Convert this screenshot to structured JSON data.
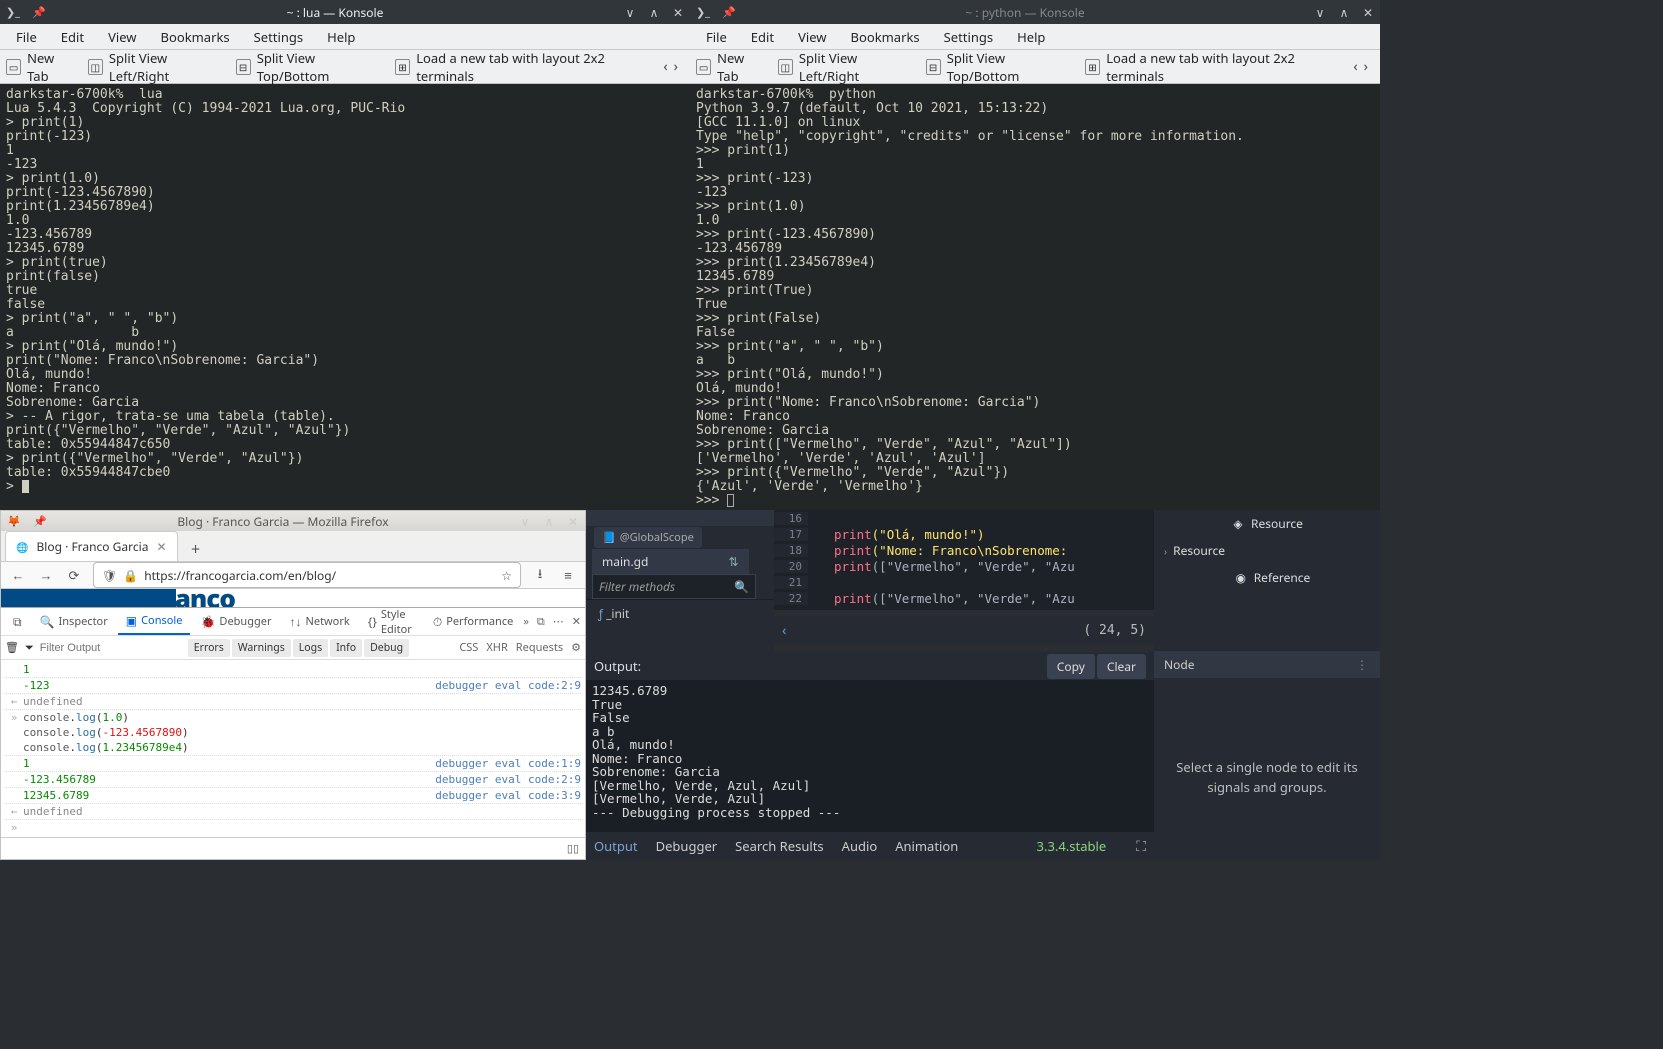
{
  "konsole_left": {
    "title": "~ : lua — Konsole",
    "menu": [
      "File",
      "Edit",
      "View",
      "Bookmarks",
      "Settings",
      "Help"
    ],
    "toolbar": {
      "new_tab": "New Tab",
      "split_lr": "Split View Left/Right",
      "split_tb": "Split View Top/Bottom",
      "load_layout": "Load a new tab with layout 2x2 terminals"
    },
    "term": "darkstar-6700k%  lua\nLua 5.4.3  Copyright (C) 1994-2021 Lua.org, PUC-Rio\n> print(1)\nprint(-123)\n1\n-123\n> print(1.0)\nprint(-123.4567890)\nprint(1.23456789e4)\n1.0\n-123.456789\n12345.6789\n> print(true)\nprint(false)\ntrue\nfalse\n> print(\"a\", \" \", \"b\")\na               b\n> print(\"Olá, mundo!\")\nprint(\"Nome: Franco\\nSobrenome: Garcia\")\nOlá, mundo!\nNome: Franco\nSobrenome: Garcia\n> -- A rigor, trata-se uma tabela (table).\nprint({\"Vermelho\", \"Verde\", \"Azul\", \"Azul\"})\ntable: 0x55944847c650\n> print({\"Vermelho\", \"Verde\", \"Azul\"})\ntable: 0x55944847cbe0\n> "
  },
  "konsole_right": {
    "title": "~ : python — Konsole",
    "menu": [
      "File",
      "Edit",
      "View",
      "Bookmarks",
      "Settings",
      "Help"
    ],
    "toolbar": {
      "new_tab": "New Tab",
      "split_lr": "Split View Left/Right",
      "split_tb": "Split View Top/Bottom",
      "load_layout": "Load a new tab with layout 2x2 terminals"
    },
    "term": "darkstar-6700k%  python\nPython 3.9.7 (default, Oct 10 2021, 15:13:22)\n[GCC 11.1.0] on linux\nType \"help\", \"copyright\", \"credits\" or \"license\" for more information.\n>>> print(1)\n1\n>>> print(-123)\n-123\n>>> print(1.0)\n1.0\n>>> print(-123.4567890)\n-123.456789\n>>> print(1.23456789e4)\n12345.6789\n>>> print(True)\nTrue\n>>> print(False)\nFalse\n>>> print(\"a\", \" \", \"b\")\na   b\n>>> print(\"Olá, mundo!\")\nOlá, mundo!\n>>> print(\"Nome: Franco\\nSobrenome: Garcia\")\nNome: Franco\nSobrenome: Garcia\n>>> print([\"Vermelho\", \"Verde\", \"Azul\", \"Azul\"])\n['Vermelho', 'Verde', 'Azul', 'Azul']\n>>> print({\"Vermelho\", \"Verde\", \"Azul\"})\n{'Azul', 'Verde', 'Vermelho'}\n>>> "
  },
  "firefox": {
    "title": "Blog · Franco Garcia — Mozilla Firefox",
    "tab": "Blog · Franco Garcia",
    "url": "https://francogarcia.com/en/blog/",
    "devtools": {
      "tabs": {
        "inspector": "Inspector",
        "console": "Console",
        "debugger": "Debugger",
        "network": "Network",
        "style": "Style Editor",
        "performance": "Performance"
      },
      "filter_placeholder": "Filter Output",
      "chips": [
        "Errors",
        "Warnings",
        "Logs",
        "Info",
        "Debug"
      ],
      "right_chips": [
        "CSS",
        "XHR",
        "Requests"
      ],
      "rows": {
        "n1": "1",
        "n123": "-123",
        "src29a": "debugger eval code:2:9",
        "undef": "undefined",
        "log1": "console.log(1.0)",
        "log2": "console.log(-123.4567890)",
        "log3": "console.log(1.23456789e4)",
        "r1": "1",
        "s1": "debugger eval code:1:9",
        "r2": "-123.456789",
        "s2": "debugger eval code:2:9",
        "r3": "12345.6789",
        "s3": "debugger eval code:3:9",
        "undef2": "undefined"
      }
    }
  },
  "godot": {
    "global": "@GlobalScope",
    "main": "main.gd",
    "filter_placeholder": "Filter methods",
    "init": "_init",
    "code": {
      "l16": "16",
      "l17": "17",
      "l18": "18",
      "l20": "20",
      "l21": "21",
      "l22": "22",
      "txt17a": "print",
      "txt17b": "(\"Olá, mundo!\")",
      "txt18a": "print",
      "txt18b": "(\"Nome: Franco\\nSobrenome:",
      "txt20a": "print",
      "txt20b": "([\"Vermelho\", \"Verde\", \"Azu",
      "txt22a": "print",
      "txt22b": "([\"Vermelho\", \"Verde\", \"Azu"
    },
    "cursor_pos": "(  24,   5)",
    "output_label": "Output:",
    "copy": "Copy",
    "clear": "Clear",
    "output_body": "12345.6789\nTrue\nFalse\na b\nOlá, mundo!\nNome: Franco\nSobrenome: Garcia\n[Vermelho, Verde, Azul, Azul]\n[Vermelho, Verde, Azul]\n--- Debugging process stopped ---",
    "bottom_tabs": {
      "output": "Output",
      "debugger": "Debugger",
      "search": "Search Results",
      "audio": "Audio",
      "animation": "Animation"
    },
    "version": "3.3.4.stable",
    "panel": {
      "resource": "Resource",
      "resource2": "Resource",
      "reference": "Reference",
      "node": "Node",
      "hint": "Select a single node to edit its signals and groups."
    }
  }
}
